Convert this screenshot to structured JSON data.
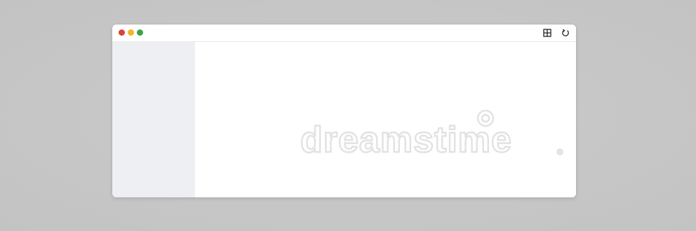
{
  "window": {
    "controls": {
      "close_color": "#d9443b",
      "minimize_color": "#f0b52a",
      "maximize_color": "#3aa34a"
    },
    "toolbar": {
      "icons": [
        "layout-grid-icon",
        "refresh-icon"
      ]
    },
    "sidebar": {
      "background": "#eeeff2"
    },
    "content": {
      "watermark_text": "dreamstime"
    }
  }
}
